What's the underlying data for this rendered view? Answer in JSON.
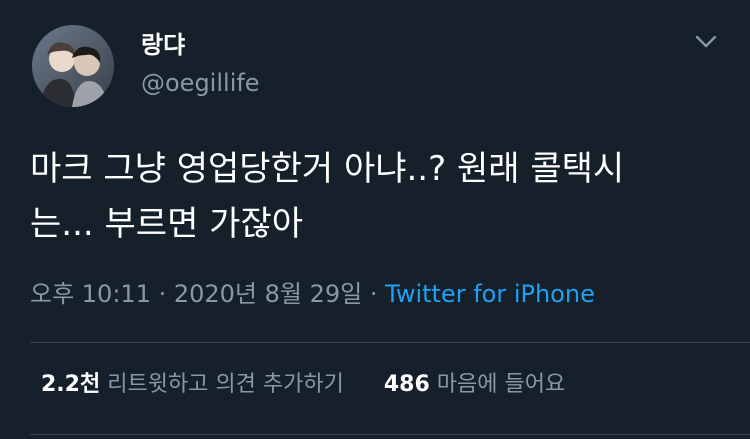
{
  "tweet": {
    "display_name": "랑댜",
    "handle": "@oegillife",
    "text": "마크 그냥 영업당한거 아냐..? 원래 콜택시\n는... 부르면 가잖아",
    "timestamp": "오후 10:11 · 2020년 8월 29일",
    "separator": " · ",
    "source": "Twitter for iPhone"
  },
  "stats": {
    "retweets_count": "2.2천",
    "retweets_label": "리트윗하고 의견 추가하기",
    "likes_count": "486",
    "likes_label": "마음에 들어요"
  },
  "icons": {
    "menu": "chevron-down-icon",
    "avatar": "profile-photo"
  },
  "colors": {
    "background": "#15202b",
    "text_primary": "#ffffff",
    "text_secondary": "#8899a6",
    "link": "#1da1f2",
    "divider": "#38444d"
  }
}
